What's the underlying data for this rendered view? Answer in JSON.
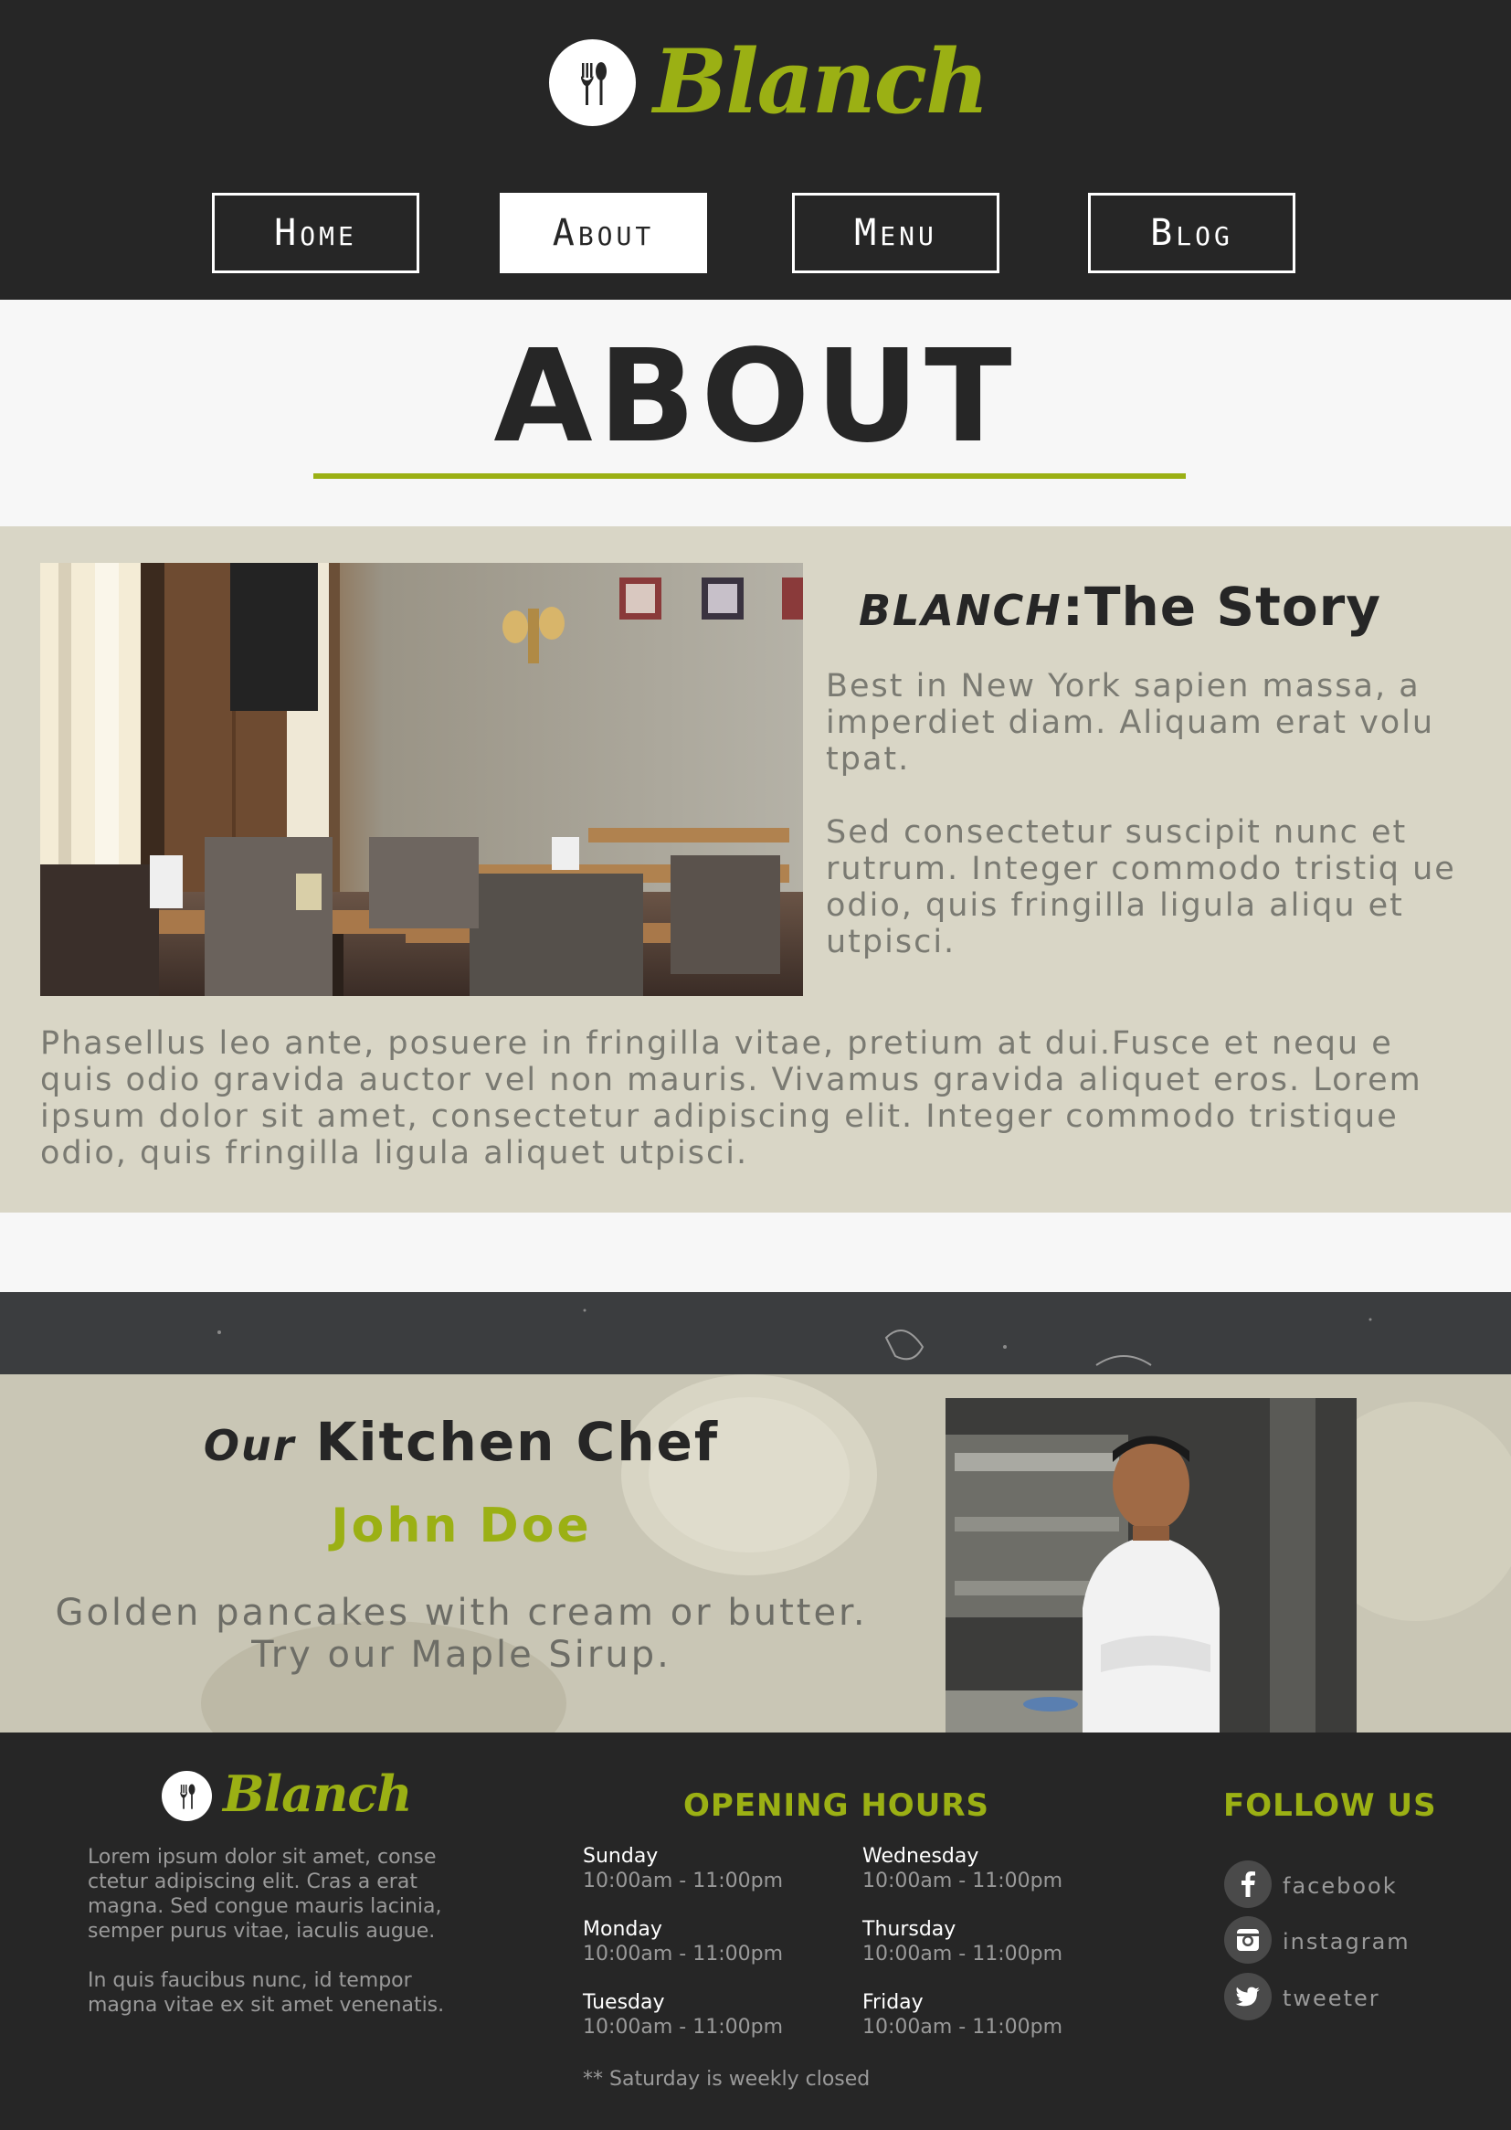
{
  "brand": {
    "name": "Blanch",
    "accent_color": "#9bb014",
    "dark_color": "#262626",
    "logo_icon": "fork-spoon-icon"
  },
  "nav": {
    "items": [
      {
        "label": "Home",
        "active": false
      },
      {
        "label": "About",
        "active": true
      },
      {
        "label": "Menu",
        "active": false
      },
      {
        "label": "Blog",
        "active": false
      }
    ]
  },
  "page": {
    "title": "ABOUT"
  },
  "story": {
    "heading_brand": "BLANCH",
    "heading_separator": ":",
    "heading_rest": "The Story",
    "para1": "Best in New York sapien massa, a imperdiet diam. Aliquam erat volu tpat.",
    "para2": "Sed consectetur suscipit nunc et rutrum. Integer commodo tristiq ue odio, quis fringilla ligula aliqu et utpisci.",
    "para3": "Phasellus leo ante, posuere in fringilla vitae, pretium at dui.Fusce et nequ e quis odio gravida auctor vel non mauris. Vivamus gravida aliquet eros. Lorem ipsum dolor sit amet, consectetur adipiscing elit. Integer commodo tristique odio, quis fringilla ligula aliquet utpisci."
  },
  "chef": {
    "heading_prefix": "Our",
    "heading_rest": "Kitchen Chef",
    "name": "John Doe",
    "desc_line1": "Golden pancakes with cream or butter.",
    "desc_line2": "Try our Maple Sirup."
  },
  "footer": {
    "about1": "Lorem ipsum dolor sit amet, conse ctetur adipiscing elit. Cras a erat magna. Sed congue mauris lacinia, semper purus vitae, iaculis augue.",
    "about2": "In quis faucibus nunc, id tempor magna vitae ex sit amet venenatis.",
    "hours_heading": "OPENING HOURS",
    "hours": [
      {
        "day": "Sunday",
        "time": "10:00am - 11:00pm"
      },
      {
        "day": "Monday",
        "time": "10:00am - 11:00pm"
      },
      {
        "day": "Tuesday",
        "time": "10:00am - 11:00pm"
      },
      {
        "day": "Wednesday",
        "time": "10:00am - 11:00pm"
      },
      {
        "day": "Thursday",
        "time": "10:00am - 11:00pm"
      },
      {
        "day": "Friday",
        "time": "10:00am - 11:00pm"
      }
    ],
    "hours_note": "** Saturday is weekly closed",
    "follow_heading": "FOLLOW US",
    "social": [
      {
        "label": "facebook",
        "icon": "facebook-icon"
      },
      {
        "label": "instagram",
        "icon": "instagram-icon"
      },
      {
        "label": "tweeter",
        "icon": "twitter-icon"
      }
    ]
  }
}
